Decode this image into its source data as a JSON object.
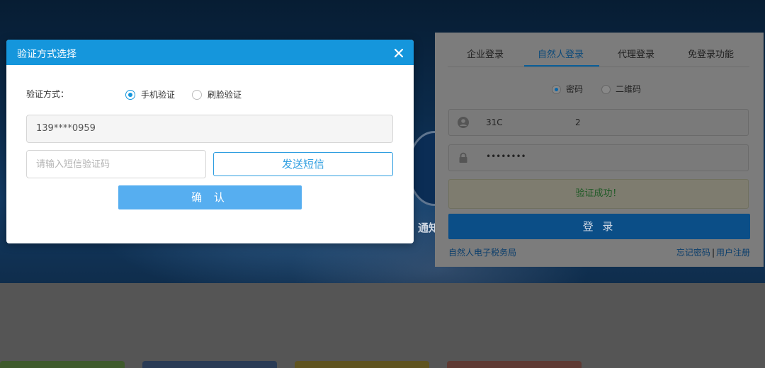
{
  "background": {
    "banner_text": "通知"
  },
  "login_panel": {
    "tabs": [
      {
        "label": "企业登录"
      },
      {
        "label": "自然人登录"
      },
      {
        "label": "代理登录"
      },
      {
        "label": "免登录功能"
      }
    ],
    "login_types": [
      {
        "label": "密码",
        "checked": true
      },
      {
        "label": "二维码",
        "checked": false
      }
    ],
    "username_part1": "31C",
    "username_part2": "2",
    "password_mask": "••••••••",
    "verify_status": "验证成功！",
    "login_button": "登 录",
    "link_left": "自然人电子税务局",
    "link_forgot": "忘记密码",
    "link_separator": "|",
    "link_register": "用户注册"
  },
  "modal": {
    "title": "验证方式选择",
    "method_label": "验证方式：",
    "options": [
      {
        "label": "手机验证",
        "checked": true
      },
      {
        "label": "刷脸验证",
        "checked": false
      }
    ],
    "phone_value": "139****0959",
    "code_placeholder": "请输入短信验证码",
    "send_sms_button": "发送短信",
    "confirm_button": "确 认"
  },
  "colors": {
    "modal_header": "#1596dc",
    "send_button_border": "#2f9ee0",
    "confirm_button": "#56aef0"
  }
}
